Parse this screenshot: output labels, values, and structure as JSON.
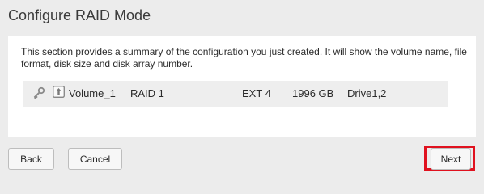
{
  "page": {
    "title": "Configure RAID Mode"
  },
  "summary": {
    "description": "This section provides a summary of the configuration you just created. It will show the volume name, file format, disk size and disk array number.",
    "volume": {
      "icons": [
        "key-icon",
        "upload-icon"
      ],
      "name": "Volume_1",
      "raid_mode": "RAID 1",
      "file_format": "EXT 4",
      "size": "1996 GB",
      "drives": "Drive1,2"
    }
  },
  "buttons": {
    "back": "Back",
    "cancel": "Cancel",
    "next": "Next"
  },
  "colors": {
    "background": "#ececec",
    "panel": "#ffffff",
    "row": "#eeeeee",
    "highlight": "#e0111e"
  }
}
